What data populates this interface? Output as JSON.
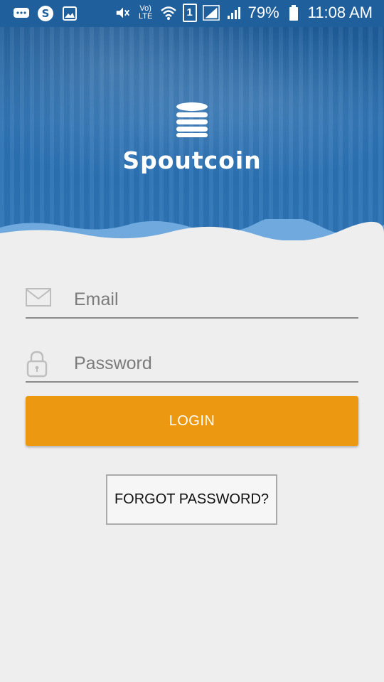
{
  "status_bar": {
    "battery_percent": "79%",
    "time": "11:08 AM",
    "volte_label": "Vo) LTE",
    "sim_label": "1",
    "icons": [
      "messages-icon",
      "skype-icon",
      "gallery-icon",
      "mute-icon",
      "volte-icon",
      "wifi-icon",
      "sim-icon",
      "signal-icon",
      "signal-icon",
      "battery-icon"
    ]
  },
  "header": {
    "brand_name": "Spoutcoin",
    "logo_icon": "coin-stack-icon",
    "accent_color": "#2a70b2"
  },
  "form": {
    "email": {
      "placeholder": "Email",
      "value": "",
      "icon": "mail-icon"
    },
    "password": {
      "placeholder": "Password",
      "value": "",
      "icon": "lock-icon"
    },
    "login_label": "LOGIN",
    "login_color": "#ec9811",
    "forgot_label": "FORGOT PASSWORD?"
  }
}
